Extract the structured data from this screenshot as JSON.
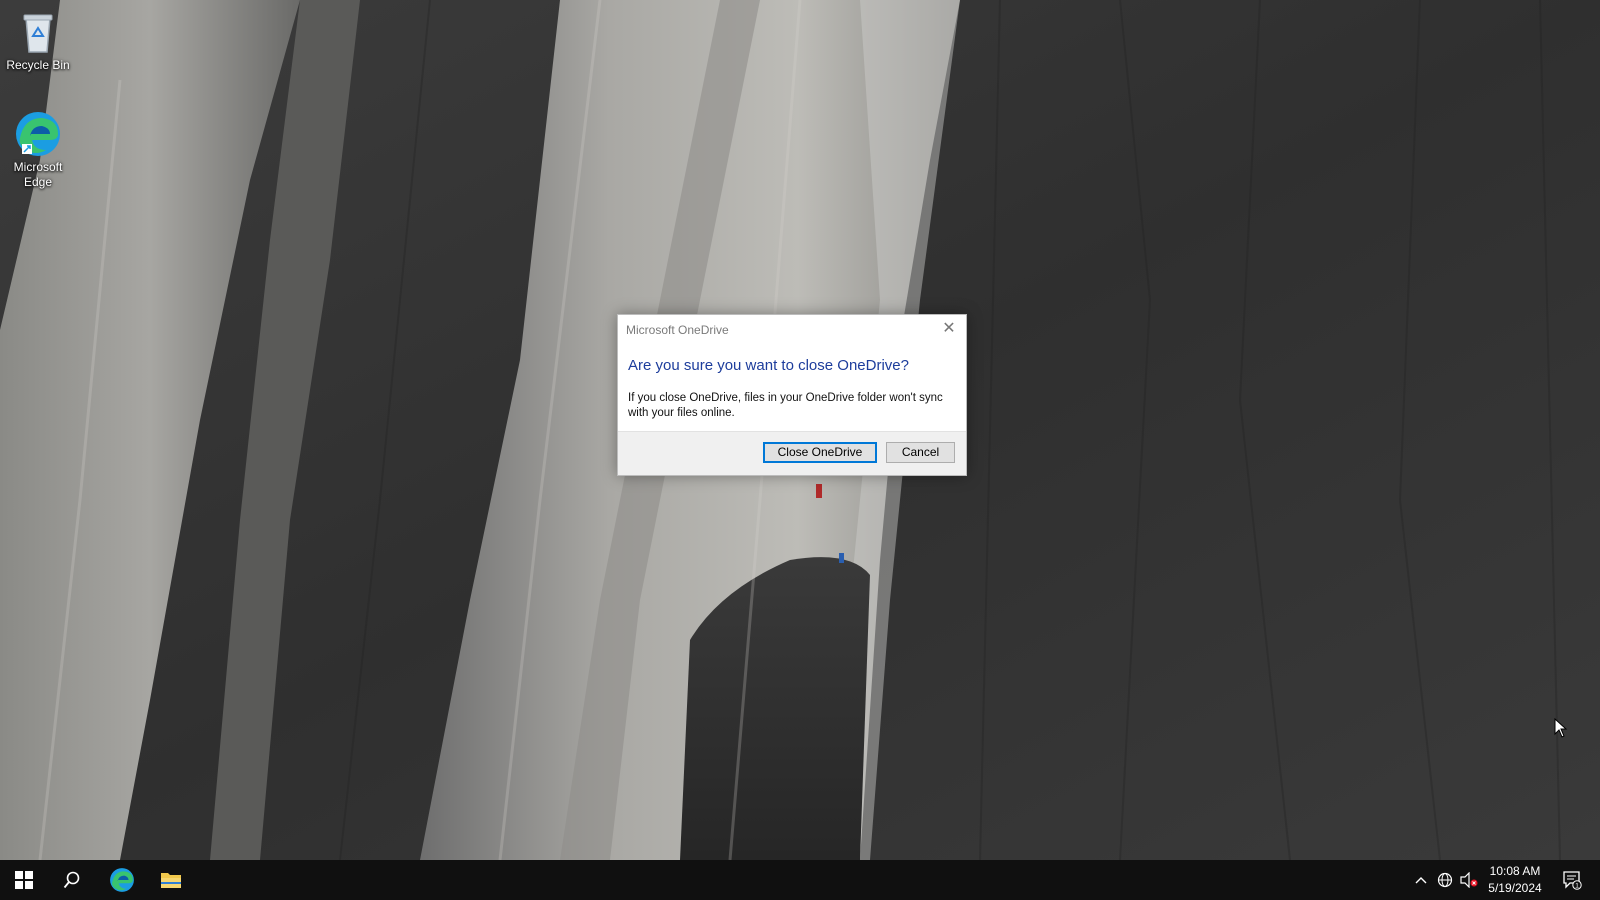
{
  "desktop": {
    "icons": [
      {
        "label": "Recycle Bin",
        "icon": "recycle-bin-icon"
      },
      {
        "label": "Microsoft\nEdge",
        "icon": "edge-icon"
      }
    ]
  },
  "dialog": {
    "title": "Microsoft OneDrive",
    "heading": "Are you sure you want to close OneDrive?",
    "body": "If you close OneDrive, files in your OneDrive folder won't sync with your files online.",
    "primary_button": "Close OneDrive",
    "secondary_button": "Cancel",
    "close_icon": "close-icon",
    "accent_color": "#0078d7",
    "heading_color": "#1d3d9c"
  },
  "taskbar": {
    "start_icon": "windows-logo-icon",
    "search_icon": "search-icon",
    "pinned": [
      "edge-icon",
      "file-explorer-icon"
    ],
    "tray": {
      "icons": [
        "chevron-up-icon",
        "network-globe-icon",
        "volume-muted-icon",
        "notification-icon"
      ],
      "time": "10:08 AM",
      "date": "5/19/2024",
      "notification_count": "1"
    }
  }
}
